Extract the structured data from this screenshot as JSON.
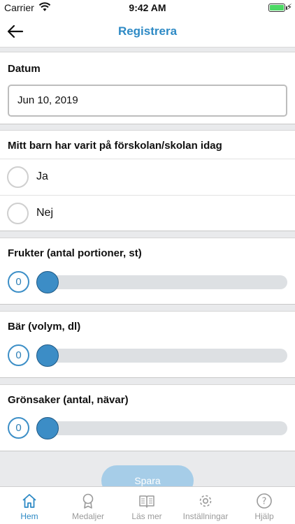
{
  "status_bar": {
    "carrier": "Carrier",
    "time": "9:42 AM"
  },
  "nav": {
    "title": "Registrera"
  },
  "date_section": {
    "label": "Datum",
    "value": "Jun 10, 2019"
  },
  "attendance": {
    "question": "Mitt barn har varit på förskolan/skolan idag",
    "options": [
      {
        "label": "Ja",
        "selected": false
      },
      {
        "label": "Nej",
        "selected": false
      }
    ]
  },
  "sliders": [
    {
      "label": "Frukter (antal portioner, st)",
      "value": "0"
    },
    {
      "label": "Bär (volym, dl)",
      "value": "0"
    },
    {
      "label": "Grönsaker (antal, nävar)",
      "value": "0"
    }
  ],
  "save_button": {
    "label": "Spara"
  },
  "tabs": [
    {
      "label": "Hem",
      "icon": "home-icon",
      "active": true
    },
    {
      "label": "Medaljer",
      "icon": "medal-icon",
      "active": false
    },
    {
      "label": "Läs mer",
      "icon": "book-icon",
      "active": false
    },
    {
      "label": "Inställningar",
      "icon": "gear-icon",
      "active": false
    },
    {
      "label": "Hjälp",
      "icon": "help-icon",
      "active": false
    }
  ],
  "colors": {
    "accent": "#2e8ac5",
    "slider_thumb": "#3c8dc6",
    "track": "#dde0e3",
    "battery": "#4cd964"
  }
}
